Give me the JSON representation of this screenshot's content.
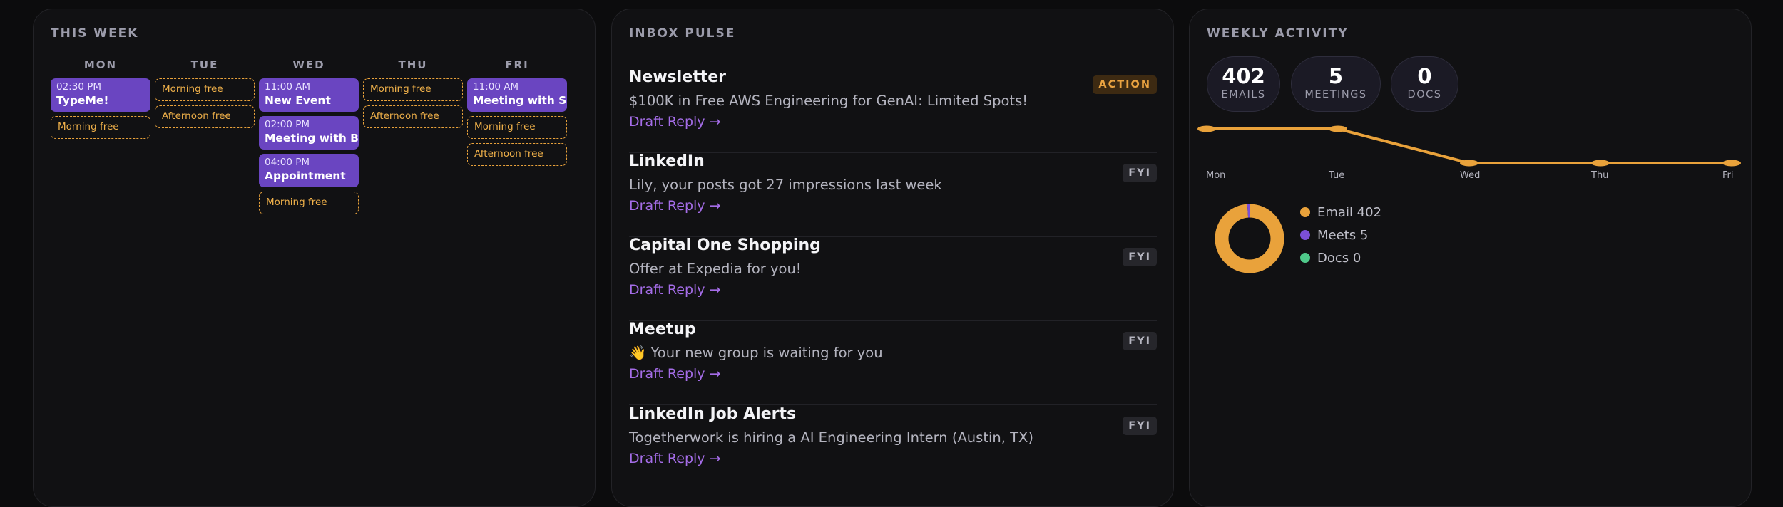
{
  "week": {
    "title": "THIS WEEK",
    "days": [
      {
        "label": "MON",
        "items": [
          {
            "kind": "event",
            "time": "02:30 PM",
            "title": "TypeMe!"
          },
          {
            "kind": "free",
            "label": "Morning free"
          }
        ]
      },
      {
        "label": "TUE",
        "items": [
          {
            "kind": "free",
            "label": "Morning free"
          },
          {
            "kind": "free",
            "label": "Afternoon free"
          }
        ]
      },
      {
        "label": "WED",
        "items": [
          {
            "kind": "event",
            "time": "11:00 AM",
            "title": "New Event"
          },
          {
            "kind": "event",
            "time": "02:00 PM",
            "title": "Meeting with Bob"
          },
          {
            "kind": "event",
            "time": "04:00 PM",
            "title": "Appointment"
          },
          {
            "kind": "free",
            "label": "Morning free"
          }
        ]
      },
      {
        "label": "THU",
        "items": [
          {
            "kind": "free",
            "label": "Morning free"
          },
          {
            "kind": "free",
            "label": "Afternoon free"
          }
        ]
      },
      {
        "label": "FRI",
        "items": [
          {
            "kind": "event",
            "time": "11:00 AM",
            "title": "Meeting with Sasha"
          },
          {
            "kind": "free",
            "label": "Morning free"
          },
          {
            "kind": "free",
            "label": "Afternoon free"
          }
        ]
      }
    ]
  },
  "inbox": {
    "title": "INBOX PULSE",
    "emails": [
      {
        "sender": "Newsletter",
        "subject": "$100K in Free AWS Engineering for GenAI: Limited Spots!",
        "reply": "Draft Reply →",
        "tag": "ACTION"
      },
      {
        "sender": "LinkedIn",
        "subject": "Lily, your posts got 27 impressions last week",
        "reply": "Draft Reply →",
        "tag": "FYI"
      },
      {
        "sender": "Capital One Shopping",
        "subject": "Offer at Expedia for you!",
        "reply": "Draft Reply →",
        "tag": "FYI"
      },
      {
        "sender": "Meetup",
        "subject": "👋 Your new group is waiting for you",
        "reply": "Draft Reply →",
        "tag": "FYI"
      },
      {
        "sender": "LinkedIn Job Alerts",
        "subject": "Togetherwork is hiring a AI Engineering Intern (Austin, TX)",
        "reply": "Draft Reply →",
        "tag": "FYI"
      }
    ]
  },
  "activity": {
    "title": "WEEKLY ACTIVITY",
    "stats": [
      {
        "value": "402",
        "label": "EMAILS"
      },
      {
        "value": "5",
        "label": "MEETINGS"
      },
      {
        "value": "0",
        "label": "DOCS"
      }
    ],
    "legend": [
      {
        "label": "Email 402",
        "color": "#e9a23b"
      },
      {
        "label": "Meets 5",
        "color": "#7b4fd6"
      },
      {
        "label": "Docs 0",
        "color": "#4fc98a"
      }
    ]
  },
  "chart_data": [
    {
      "type": "line",
      "categories": [
        "Mon",
        "Tue",
        "Wed",
        "Thu",
        "Fri"
      ],
      "series": [
        {
          "values": [
            1,
            1,
            0,
            0,
            0
          ],
          "color": "#e9a23b"
        }
      ],
      "grid": false
    },
    {
      "type": "pie",
      "labels": [
        "Email",
        "Meets",
        "Docs"
      ],
      "values": [
        402,
        5,
        0
      ],
      "colors": [
        "#e9a23b",
        "#7b4fd6",
        "#4fc98a"
      ]
    }
  ]
}
